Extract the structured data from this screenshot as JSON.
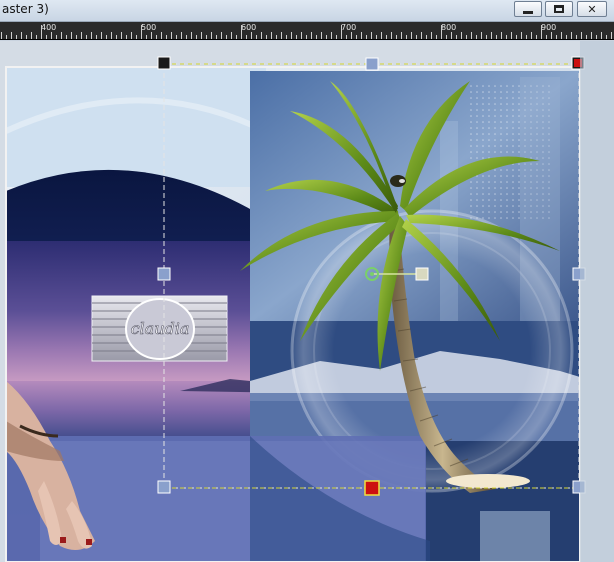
{
  "window": {
    "title_fragment": "aster 3)",
    "buttons": {
      "minimize": "minimize-icon",
      "maximize": "maximize-icon",
      "close": "close-icon"
    }
  },
  "ruler": {
    "labels": [
      "400",
      "500",
      "600",
      "700",
      "800",
      "900"
    ]
  },
  "watermark": {
    "text": "claudia"
  },
  "icons": {
    "palm": "palm-tree-icon",
    "rotation_handle": "rotation-handle-icon",
    "pick_handle": "pick-tool-handle-icon"
  },
  "colors": {
    "sky_light": "#dbe7f4",
    "navy": "#0e1f55",
    "sunset_purple": "#7e5a9c",
    "palm_green": "#5a8a16",
    "selection_line": "#d6d630",
    "handle_blue": "#8aa0cc",
    "handle_red": "#cc1010"
  }
}
